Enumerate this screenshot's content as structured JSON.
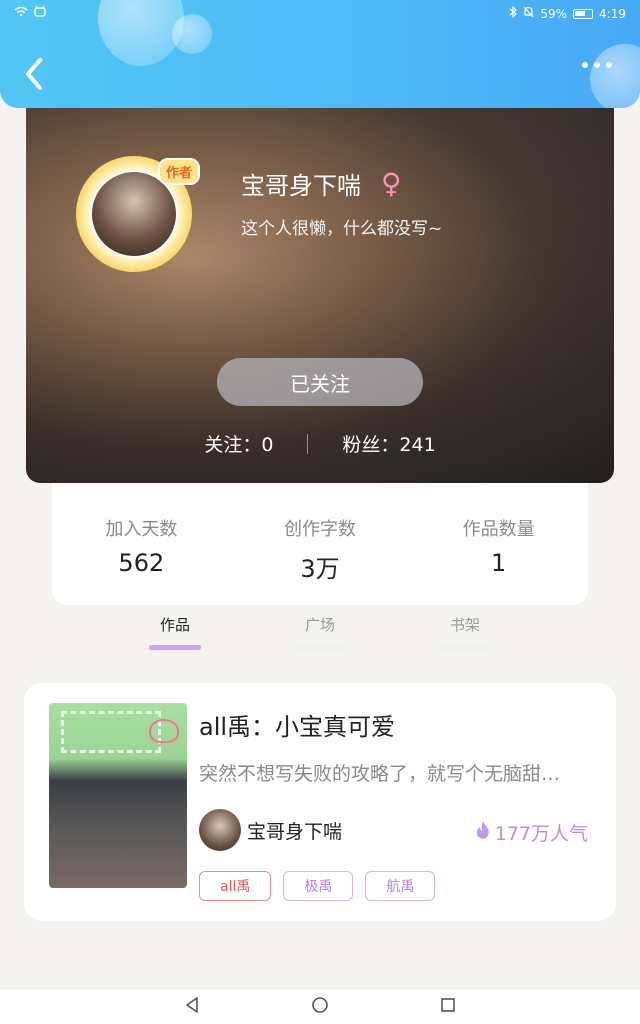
{
  "status_bar": {
    "battery": "59%",
    "time": "4:19"
  },
  "profile": {
    "nickname": "宝哥身下喘",
    "gender_symbol": "♀",
    "bio": "这个人很懒，什么都没写~",
    "author_badge": "作者",
    "follow_button": "已关注",
    "following_label": "关注：0",
    "followers_label": "粉丝：241"
  },
  "stats": [
    {
      "label": "加入天数",
      "value": "562"
    },
    {
      "label": "创作字数",
      "value": "3万"
    },
    {
      "label": "作品数量",
      "value": "1"
    }
  ],
  "tabs": [
    {
      "label": "作品",
      "active": true
    },
    {
      "label": "广场",
      "active": false
    },
    {
      "label": "书架",
      "active": false
    }
  ],
  "book": {
    "title": "all禹：小宝真可爱",
    "description": "突然不想写失败的攻略了，就写个无脑甜…",
    "author": "宝哥身下喘",
    "popularity": "177万人气",
    "tags": [
      "all禹",
      "极禹",
      "航禹"
    ]
  },
  "colors": {
    "header": "#4db9f7",
    "accent": "#c8a6ee",
    "tag_red": "#e55b5b",
    "tag_purple": "#b385e8"
  }
}
